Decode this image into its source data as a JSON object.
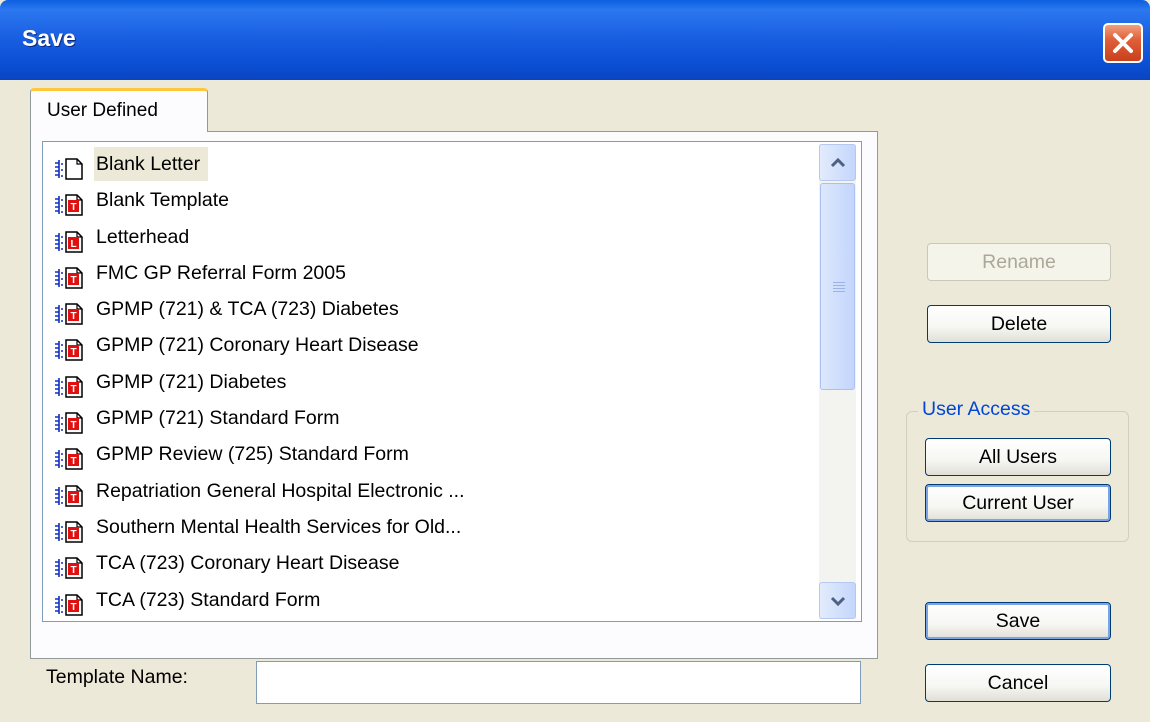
{
  "window": {
    "title": "Save"
  },
  "tabs": [
    {
      "label": "User Defined",
      "active": true
    }
  ],
  "templates": {
    "items": [
      {
        "label": "Blank Letter",
        "icon": "blank-document-icon",
        "selected": true
      },
      {
        "label": "Blank Template",
        "icon": "template-document-icon"
      },
      {
        "label": "Letterhead",
        "icon": "letterhead-document-icon"
      },
      {
        "label": "FMC GP Referral Form 2005",
        "icon": "template-document-icon"
      },
      {
        "label": "GPMP (721) & TCA (723) Diabetes",
        "icon": "template-document-icon"
      },
      {
        "label": "GPMP (721) Coronary Heart Disease",
        "icon": "template-document-icon"
      },
      {
        "label": "GPMP (721) Diabetes",
        "icon": "template-document-icon"
      },
      {
        "label": "GPMP (721) Standard Form",
        "icon": "template-document-icon"
      },
      {
        "label": "GPMP Review (725) Standard Form",
        "icon": "template-document-icon"
      },
      {
        "label": "Repatriation General Hospital Electronic ...",
        "icon": "template-document-icon"
      },
      {
        "label": "Southern Mental Health Services for Old...",
        "icon": "template-document-icon"
      },
      {
        "label": "TCA (723) Coronary Heart Disease",
        "icon": "template-document-icon"
      },
      {
        "label": "TCA (723) Standard Form",
        "icon": "template-document-icon"
      }
    ]
  },
  "buttons": {
    "rename": "Rename",
    "delete": "Delete",
    "all_users": "All Users",
    "current_user": "Current User",
    "save": "Save",
    "cancel": "Cancel"
  },
  "user_access": {
    "label": "User Access"
  },
  "template_name": {
    "label": "Template Name:",
    "value": ""
  },
  "colors": {
    "titlebar": "#0b4fd4",
    "dialog_bg": "#ece9d8",
    "group_label": "#0046d5",
    "icon_red": "#e01010",
    "icon_blue": "#1030c0"
  }
}
